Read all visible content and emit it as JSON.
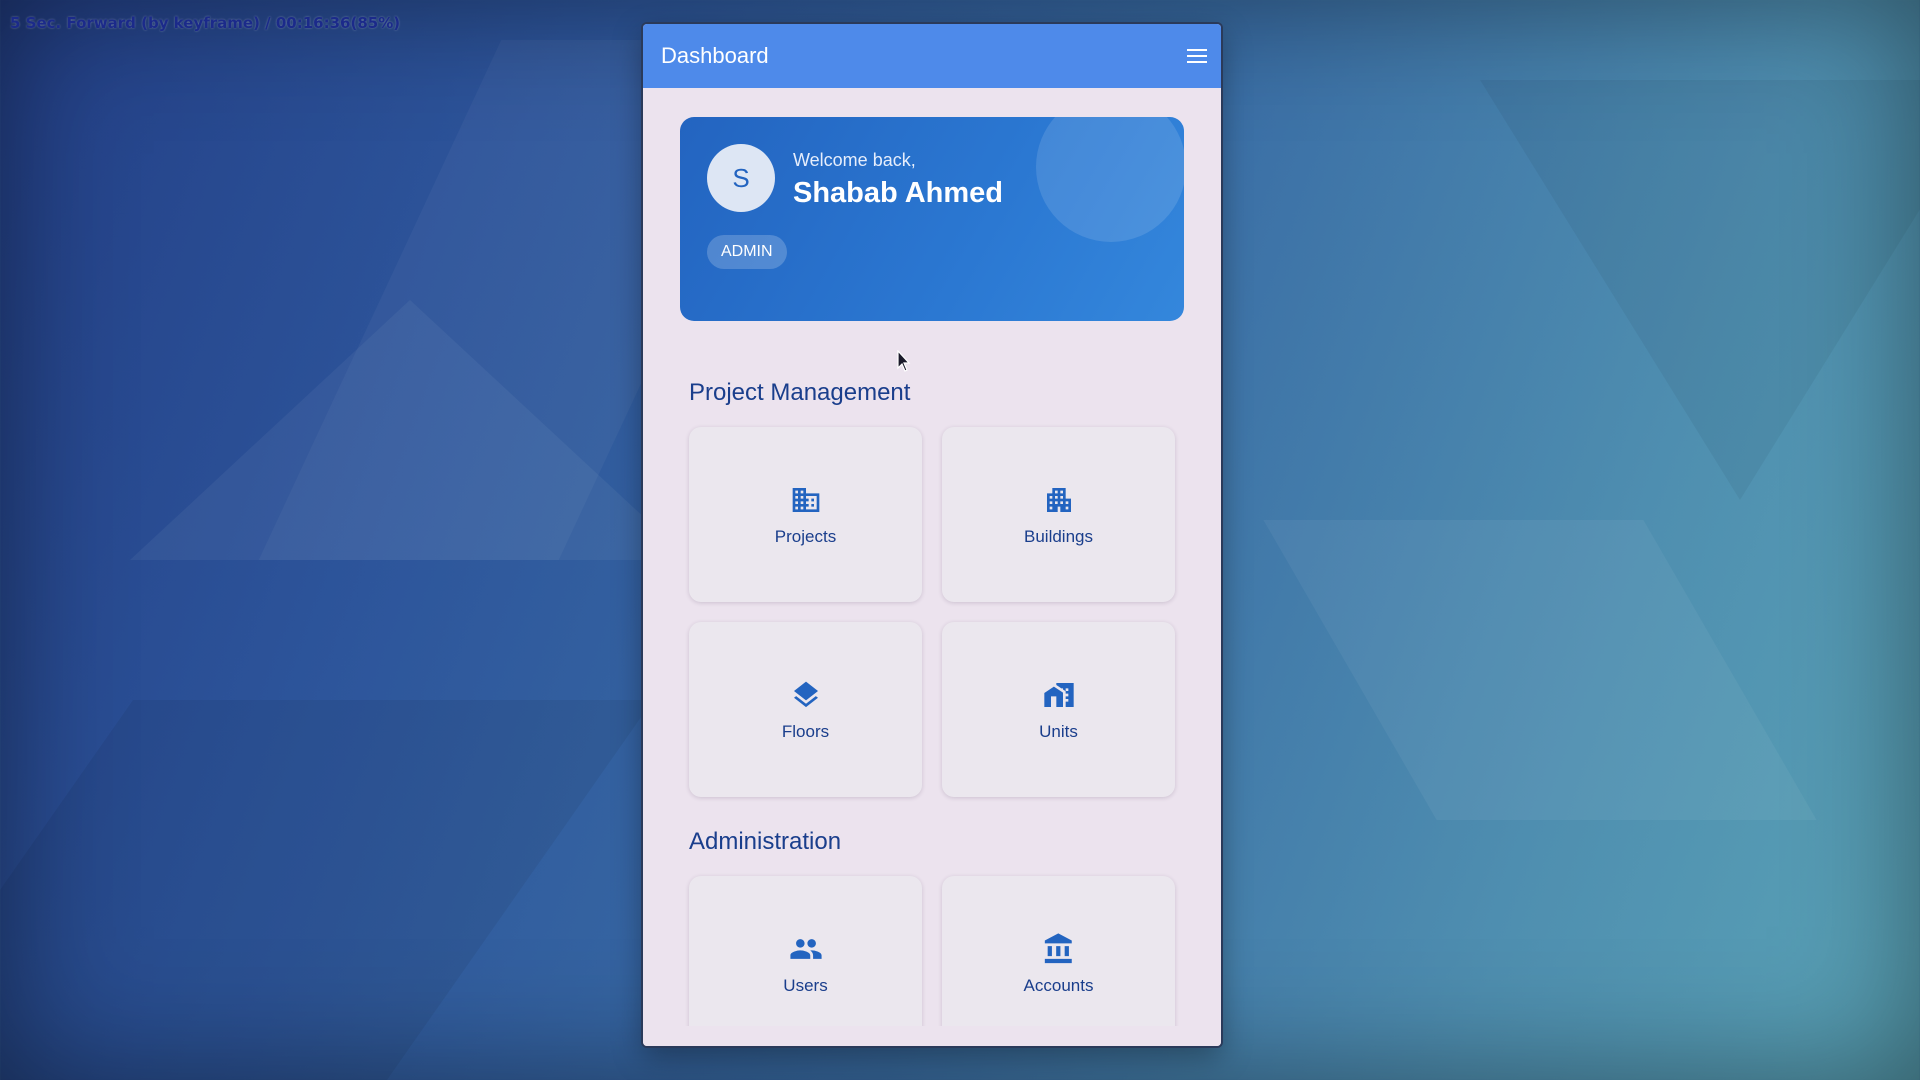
{
  "overlay": {
    "status_text": "5 Sec. Forward (by keyframe) / 00:16:36(85%)"
  },
  "appbar": {
    "title": "Dashboard",
    "menu_icon": "menu-icon"
  },
  "welcome": {
    "greeting": "Welcome back,",
    "name": "Shabab Ahmed",
    "avatar_initial": "S",
    "role": "ADMIN"
  },
  "sections": [
    {
      "title": "Project Management",
      "tiles": [
        {
          "label": "Projects",
          "icon": "apartment-icon"
        },
        {
          "label": "Buildings",
          "icon": "business-icon"
        },
        {
          "label": "Floors",
          "icon": "layers-icon"
        },
        {
          "label": "Units",
          "icon": "home-work-icon"
        }
      ]
    },
    {
      "title": "Administration",
      "tiles": [
        {
          "label": "Users",
          "icon": "people-icon"
        },
        {
          "label": "Accounts",
          "icon": "bank-icon"
        }
      ]
    }
  ],
  "colors": {
    "appbar": "#4e8aea",
    "card_gradient_start": "#2364c0",
    "card_gradient_end": "#3487dc",
    "primary_text": "#1a3e8c",
    "icon": "#2364c0",
    "surface": "#ece3ee"
  }
}
